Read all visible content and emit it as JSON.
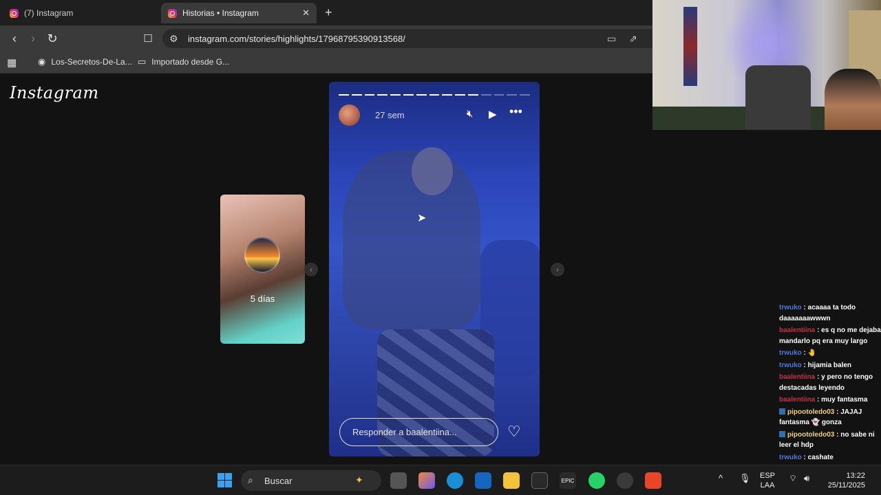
{
  "browser": {
    "tabs": [
      {
        "title": "(7) Instagram",
        "active": false
      },
      {
        "title": "Historias • Instagram",
        "active": true
      }
    ],
    "new_tab": "+",
    "close_tab": "✕",
    "url": "instagram.com/stories/highlights/17968795390913568/",
    "bookmarks": [
      {
        "label": "Los-Secretos-De-La..."
      },
      {
        "label": "Importado desde G..."
      }
    ]
  },
  "instagram": {
    "logo": "Instagram",
    "prev_story": {
      "label": "5 días"
    },
    "story": {
      "time": "27 sem",
      "progress_total": 15,
      "progress_done": 11,
      "reply_placeholder": "Responder a baalentiina..."
    }
  },
  "chat": {
    "messages": [
      {
        "user": "trwuko",
        "text": "acaaaa ta todo daaaaaaawwwn",
        "color": "t"
      },
      {
        "user": "baalentiina",
        "text": "es q no me dejaba mandarlo pq era muy largo",
        "color": "b"
      },
      {
        "user": "trwuko",
        "text": "🤚",
        "color": "t"
      },
      {
        "user": "trwuko",
        "text": "hijamia balen",
        "color": "t"
      },
      {
        "user": "baalentiina",
        "text": "y pero no tengo destacadas leyendo",
        "color": "b"
      },
      {
        "user": "baalentiina",
        "text": "muy fantasma",
        "color": "b"
      },
      {
        "user": "pipootoledo03",
        "text": "JAJAJ fantasma 👻 gonza",
        "color": "p"
      },
      {
        "user": "pipootoledo03",
        "text": "no sabe ni leer el hdp",
        "color": "p"
      },
      {
        "user": "trwuko",
        "text": "cashate",
        "color": "t"
      }
    ]
  },
  "taskbar": {
    "search_placeholder": "Buscar",
    "language": "ESP",
    "layout": "LAA",
    "time": "13:22",
    "date": "25/11/2025"
  },
  "colors": {
    "accent_ig": "#e1306c",
    "story_blue": "#2a45b8"
  }
}
